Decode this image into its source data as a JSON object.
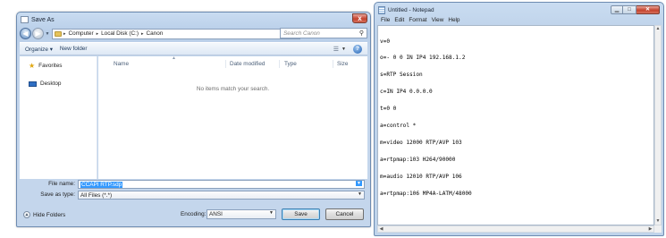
{
  "save_as": {
    "title": "Save As",
    "close_label": "x",
    "breadcrumb": [
      "Computer",
      "Local Disk (C:)",
      "Canon"
    ],
    "search_placeholder": "Search Canon",
    "toolbar": {
      "organize": "Organize ▾",
      "new_folder": "New folder"
    },
    "nav": [
      {
        "label": "Favorites",
        "icon": "star-icon"
      },
      {
        "label": "Desktop",
        "icon": "desktop-icon"
      }
    ],
    "columns": [
      "Name",
      "Date modified",
      "Type",
      "Size"
    ],
    "empty_message": "No items match your search.",
    "file_name_label": "File name:",
    "file_name_value": "CCAPI RTP.sdp",
    "save_type_label": "Save as type:",
    "save_type_value": "All Files (*.*)",
    "hide_folders": "Hide Folders",
    "encoding_label": "Encoding:",
    "encoding_value": "ANSI",
    "save_button": "Save",
    "cancel_button": "Cancel"
  },
  "notepad": {
    "title": "Untitled - Notepad",
    "menu": [
      "File",
      "Edit",
      "Format",
      "View",
      "Help"
    ],
    "lines": [
      "v=0",
      "o=- 0 0 IN IP4 192.168.1.2",
      "s=RTP Session",
      "c=IN IP4 0.0.0.0",
      "t=0 0",
      "a=control *",
      "m=video 12000 RTP/AVP 103",
      "a=rtpmap:103 H264/90000",
      "m=audio 12010 RTP/AVP 106",
      "a=rtpmap:106 MP4A-LATM/48000"
    ]
  },
  "colors": {
    "accent": "#3399ff",
    "title_close": "#c4432e",
    "frame": "#c9dcf1"
  }
}
